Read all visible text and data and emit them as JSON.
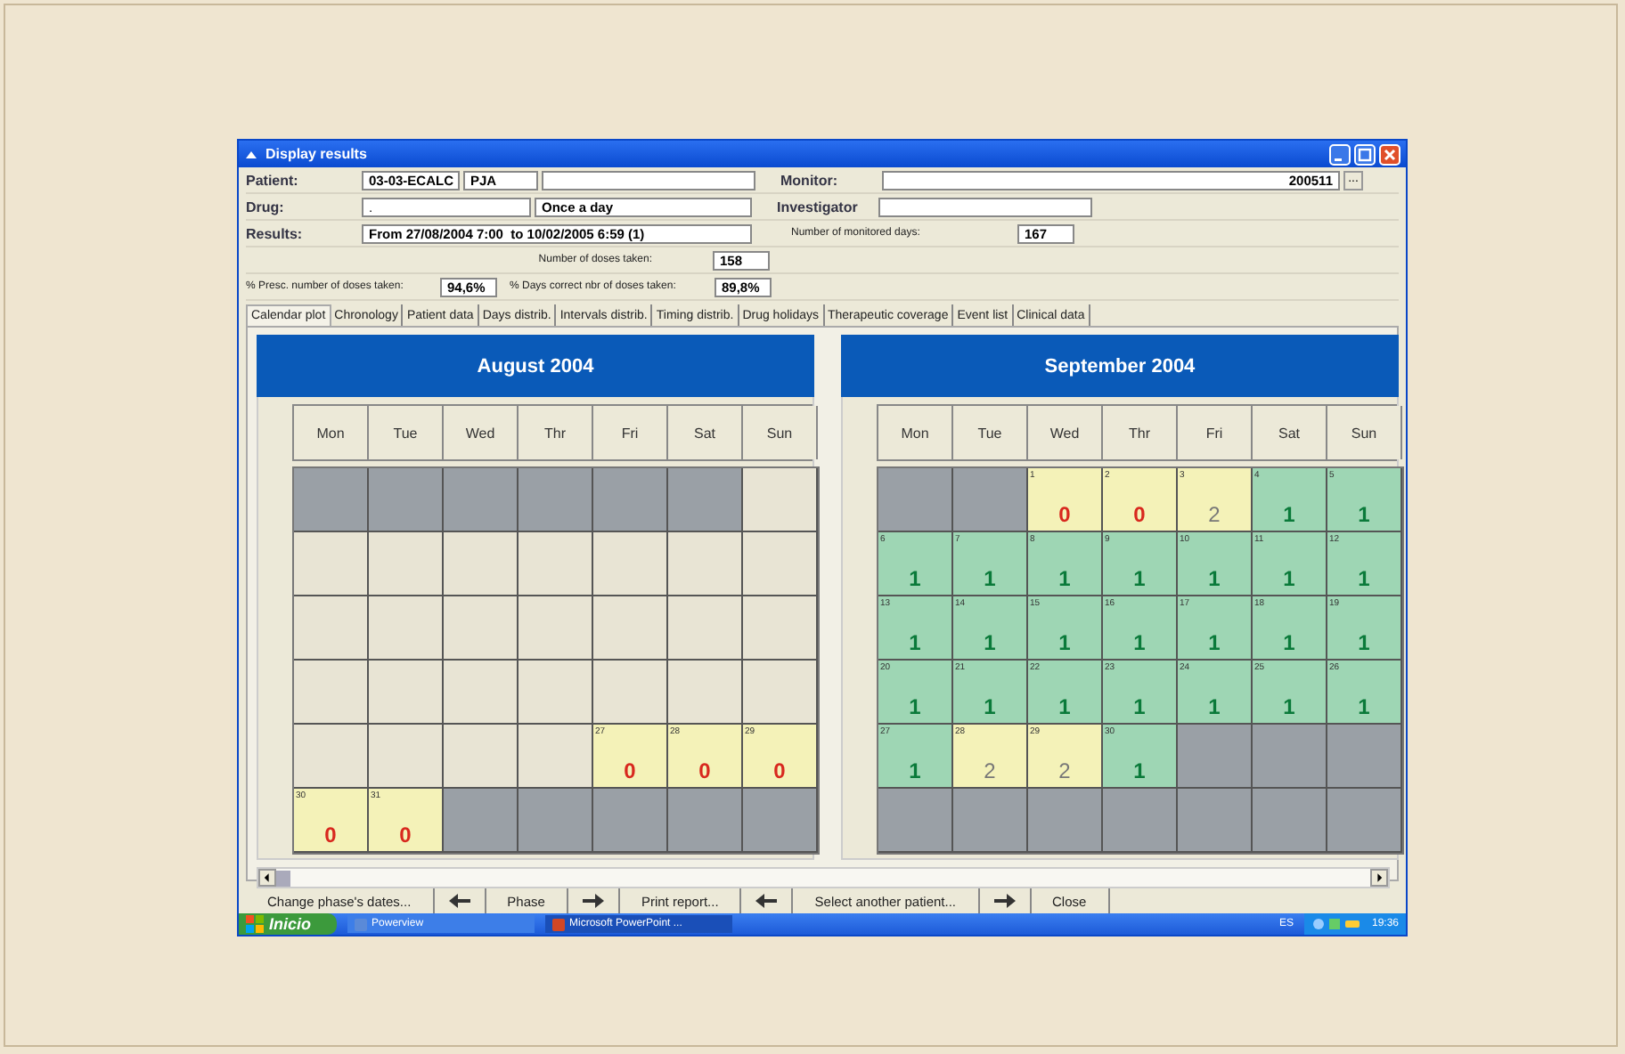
{
  "window": {
    "title": "Display results"
  },
  "form": {
    "patient_label": "Patient:",
    "patient_code": "03-03-ECALC",
    "patient_initials": "PJA",
    "monitor_label": "Monitor:",
    "monitor_value": "200511",
    "browse_button": "...",
    "drug_label": "Drug:",
    "drug_value": ".",
    "dosage": "Once a day",
    "investigator_label": "Investigator",
    "results_label": "Results:",
    "results_period": "From 27/08/2004 7:00  to 10/02/2005 6:59 (1)",
    "monitored_days_label": "Number of monitored days:",
    "monitored_days": "167",
    "doses_taken_label": "Number of doses taken:",
    "doses_taken": "158",
    "presc_label": "% Presc. number of doses taken:",
    "presc_value": "94,6%",
    "correct_days_label": "% Days correct nbr of doses taken:",
    "correct_days_value": "89,8%"
  },
  "tabs": [
    {
      "label": "Calendar plot",
      "selected": true
    },
    {
      "label": "Chronology",
      "selected": false
    },
    {
      "label": "Patient data",
      "selected": false
    },
    {
      "label": "Days distrib.",
      "selected": false
    },
    {
      "label": "Intervals distrib.",
      "selected": false
    },
    {
      "label": "Timing distrib.",
      "selected": false
    },
    {
      "label": "Drug holidays",
      "selected": false
    },
    {
      "label": "Therapeutic coverage",
      "selected": false
    },
    {
      "label": "Event list",
      "selected": false
    },
    {
      "label": "Clinical data",
      "selected": false
    }
  ],
  "calendars": [
    {
      "title": "August 2004",
      "weekdays": [
        "Mon",
        "Tue",
        "Wed",
        "Thr",
        "Fri",
        "Sat",
        "Sun"
      ],
      "weeks": [
        [
          {
            "kind": "outside"
          },
          {
            "kind": "outside"
          },
          {
            "kind": "outside"
          },
          {
            "kind": "outside"
          },
          {
            "kind": "outside"
          },
          {
            "kind": "outside"
          },
          {
            "kind": "blank"
          }
        ],
        [
          {
            "kind": "blank"
          },
          {
            "kind": "blank"
          },
          {
            "kind": "blank"
          },
          {
            "kind": "blank"
          },
          {
            "kind": "blank"
          },
          {
            "kind": "blank"
          },
          {
            "kind": "blank"
          }
        ],
        [
          {
            "kind": "blank"
          },
          {
            "kind": "blank"
          },
          {
            "kind": "blank"
          },
          {
            "kind": "blank"
          },
          {
            "kind": "blank"
          },
          {
            "kind": "blank"
          },
          {
            "kind": "blank"
          }
        ],
        [
          {
            "kind": "blank"
          },
          {
            "kind": "blank"
          },
          {
            "kind": "blank"
          },
          {
            "kind": "blank"
          },
          {
            "kind": "blank"
          },
          {
            "kind": "blank"
          },
          {
            "kind": "blank"
          }
        ],
        [
          {
            "kind": "blank"
          },
          {
            "kind": "blank"
          },
          {
            "kind": "blank"
          },
          {
            "kind": "blank"
          },
          {
            "kind": "missed",
            "date": "27",
            "count": "0"
          },
          {
            "kind": "missed",
            "date": "28",
            "count": "0"
          },
          {
            "kind": "missed",
            "date": "29",
            "count": "0"
          }
        ],
        [
          {
            "kind": "missed",
            "date": "30",
            "count": "0"
          },
          {
            "kind": "missed",
            "date": "31",
            "count": "0"
          },
          {
            "kind": "outside"
          },
          {
            "kind": "outside"
          },
          {
            "kind": "outside"
          },
          {
            "kind": "outside"
          },
          {
            "kind": "outside"
          }
        ]
      ]
    },
    {
      "title": "September 2004",
      "weekdays": [
        "Mon",
        "Tue",
        "Wed",
        "Thr",
        "Fri",
        "Sat",
        "Sun"
      ],
      "weeks": [
        [
          {
            "kind": "outside"
          },
          {
            "kind": "outside"
          },
          {
            "kind": "missed",
            "date": "1",
            "count": "0"
          },
          {
            "kind": "missed",
            "date": "2",
            "count": "0"
          },
          {
            "kind": "extra",
            "date": "3",
            "count": "2"
          },
          {
            "kind": "correct",
            "date": "4",
            "count": "1"
          },
          {
            "kind": "correct",
            "date": "5",
            "count": "1"
          }
        ],
        [
          {
            "kind": "correct",
            "date": "6",
            "count": "1"
          },
          {
            "kind": "correct",
            "date": "7",
            "count": "1"
          },
          {
            "kind": "correct",
            "date": "8",
            "count": "1"
          },
          {
            "kind": "correct",
            "date": "9",
            "count": "1"
          },
          {
            "kind": "correct",
            "date": "10",
            "count": "1"
          },
          {
            "kind": "correct",
            "date": "11",
            "count": "1"
          },
          {
            "kind": "correct",
            "date": "12",
            "count": "1"
          }
        ],
        [
          {
            "kind": "correct",
            "date": "13",
            "count": "1"
          },
          {
            "kind": "correct",
            "date": "14",
            "count": "1"
          },
          {
            "kind": "correct",
            "date": "15",
            "count": "1"
          },
          {
            "kind": "correct",
            "date": "16",
            "count": "1"
          },
          {
            "kind": "correct",
            "date": "17",
            "count": "1"
          },
          {
            "kind": "correct",
            "date": "18",
            "count": "1"
          },
          {
            "kind": "correct",
            "date": "19",
            "count": "1"
          }
        ],
        [
          {
            "kind": "correct",
            "date": "20",
            "count": "1"
          },
          {
            "kind": "correct",
            "date": "21",
            "count": "1"
          },
          {
            "kind": "correct",
            "date": "22",
            "count": "1"
          },
          {
            "kind": "correct",
            "date": "23",
            "count": "1"
          },
          {
            "kind": "correct",
            "date": "24",
            "count": "1"
          },
          {
            "kind": "correct",
            "date": "25",
            "count": "1"
          },
          {
            "kind": "correct",
            "date": "26",
            "count": "1"
          }
        ],
        [
          {
            "kind": "correct",
            "date": "27",
            "count": "1"
          },
          {
            "kind": "extra",
            "date": "28",
            "count": "2"
          },
          {
            "kind": "extra",
            "date": "29",
            "count": "2"
          },
          {
            "kind": "correct",
            "date": "30",
            "count": "1"
          },
          {
            "kind": "outside"
          },
          {
            "kind": "outside"
          },
          {
            "kind": "outside"
          }
        ],
        [
          {
            "kind": "outside"
          },
          {
            "kind": "outside"
          },
          {
            "kind": "outside"
          },
          {
            "kind": "outside"
          },
          {
            "kind": "outside"
          },
          {
            "kind": "outside"
          },
          {
            "kind": "outside"
          }
        ]
      ]
    }
  ],
  "buttons": [
    {
      "kind": "text",
      "label": "Change phase's dates..."
    },
    {
      "kind": "back"
    },
    {
      "kind": "text",
      "label": "Phase"
    },
    {
      "kind": "forward"
    },
    {
      "kind": "text",
      "label": "Print report..."
    },
    {
      "kind": "back"
    },
    {
      "kind": "text",
      "label": "Select another patient..."
    },
    {
      "kind": "forward"
    },
    {
      "kind": "text",
      "label": "Close"
    }
  ],
  "taskbar": {
    "start": "Inicio",
    "tasks": [
      {
        "label": "Powerview",
        "selected": false
      },
      {
        "label": "Microsoft PowerPoint ...",
        "selected": true
      }
    ],
    "language": "ES",
    "time": "19:36"
  }
}
